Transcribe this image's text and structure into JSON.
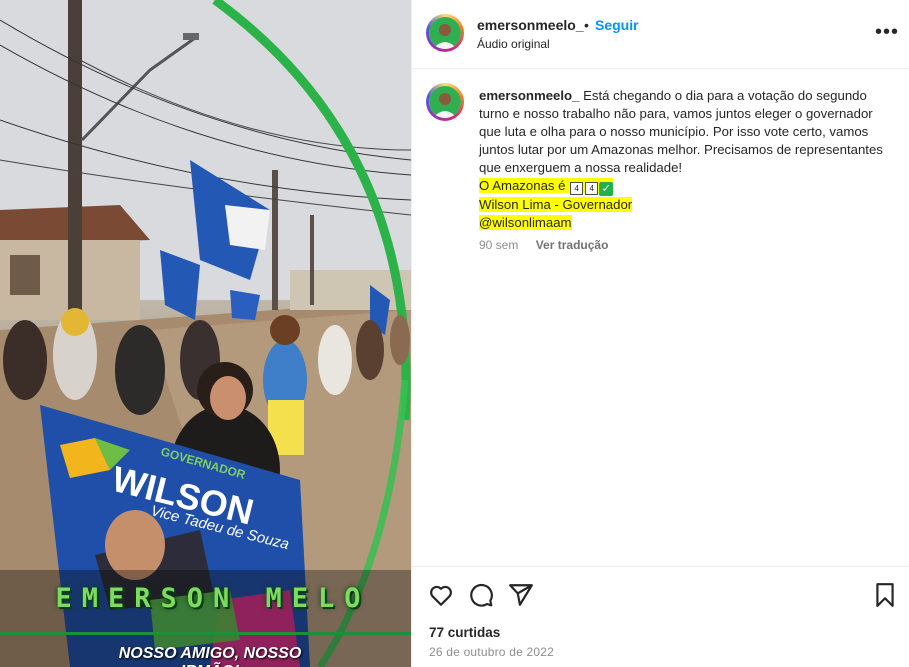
{
  "media": {
    "overlay_name": "EMERSON MELO",
    "overlay_tagline": "NOSSO AMIGO, NOSSO IRMÃO!",
    "banner": {
      "top_label": "GOVERNADOR",
      "name": "WILSON",
      "vice": "Vice Tadeu de Souza"
    }
  },
  "header": {
    "username": "emersonmeelo_",
    "separator": "•",
    "follow_label": "Seguir",
    "audio_label": "Áudio original",
    "more_label": "•••"
  },
  "caption": {
    "username": "emersonmeelo_",
    "text": "Está chegando o dia para a votação do segundo turno e nosso trabalho não para, vamos juntos eleger o governador que luta e olha para o nosso município. Por isso vote certo, vamos juntos lutar por um Amazonas melhor. Precisamos de representantes que enxerguem a nossa realidade!",
    "line1_prefix": "O Amazonas é ",
    "line1_box1": "4",
    "line1_box2": "4",
    "line1_check": "✓",
    "line2": "Wilson Lima - Governador",
    "line3": "@wilsonlimaam",
    "age": "90 sem",
    "translate_label": "Ver tradução"
  },
  "footer": {
    "likes": "77 curtidas",
    "date": "26 de outubro de 2022"
  },
  "colors": {
    "follow": "#0095f6",
    "highlight": "#ffff00",
    "overlay_green": "#7ddc5c",
    "banner_blue": "#1f4fa8"
  },
  "icons": [
    "heart-icon",
    "comment-icon",
    "share-icon",
    "bookmark-icon",
    "more-icon"
  ]
}
